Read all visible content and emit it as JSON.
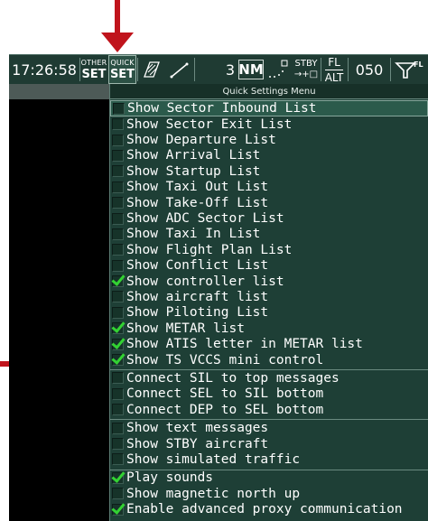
{
  "colors": {
    "annotation_arrow": "#c0141c",
    "menu_bg": "#1e3f36",
    "check": "#33d233"
  },
  "toolbar": {
    "clock": "17:26:58",
    "other_set": {
      "top": "OTHER",
      "bottom": "SET"
    },
    "quick_set": {
      "top": "QUICK",
      "bottom": "SET"
    },
    "range": "3",
    "unit": "NM",
    "stby": {
      "top": "STBY",
      "bottom": "→+□"
    },
    "fl_alt": {
      "top": "FL",
      "bottom": "ALT"
    },
    "level": "050",
    "filter_badge": "FL"
  },
  "menu": {
    "title": "Quick Settings Menu",
    "groups": [
      [
        {
          "label": "Show Sector Inbound List",
          "checked": false
        },
        {
          "label": "Show Sector Exit List",
          "checked": false
        },
        {
          "label": "Show Departure List",
          "checked": false
        },
        {
          "label": "Show Arrival List",
          "checked": false
        },
        {
          "label": "Show Startup List",
          "checked": false
        },
        {
          "label": "Show Taxi Out List",
          "checked": false
        },
        {
          "label": "Show Take-Off List",
          "checked": false
        },
        {
          "label": "Show ADC Sector List",
          "checked": false
        },
        {
          "label": "Show Taxi In List",
          "checked": false
        },
        {
          "label": "Show Flight Plan List",
          "checked": false
        },
        {
          "label": "Show Conflict List",
          "checked": false
        },
        {
          "label": "Show controller list",
          "checked": true
        },
        {
          "label": "Show aircraft list",
          "checked": false
        },
        {
          "label": "Show Piloting List",
          "checked": false
        },
        {
          "label": "Show METAR list",
          "checked": true
        },
        {
          "label": "Show ATIS letter in METAR list",
          "checked": true
        },
        {
          "label": "Show TS VCCS mini control",
          "checked": true
        }
      ],
      [
        {
          "label": "Connect SIL to top messages",
          "checked": false
        },
        {
          "label": "Connect SEL to SIL bottom",
          "checked": false
        },
        {
          "label": "Connect DEP to SEL bottom",
          "checked": false
        }
      ],
      [
        {
          "label": "Show text messages",
          "checked": false
        },
        {
          "label": "Show STBY aircraft",
          "checked": false
        },
        {
          "label": "Show simulated traffic",
          "checked": false
        }
      ],
      [
        {
          "label": "Play sounds",
          "checked": true
        },
        {
          "label": "Show magnetic north up",
          "checked": false
        },
        {
          "label": "Enable advanced proxy communication",
          "checked": true
        }
      ]
    ]
  }
}
